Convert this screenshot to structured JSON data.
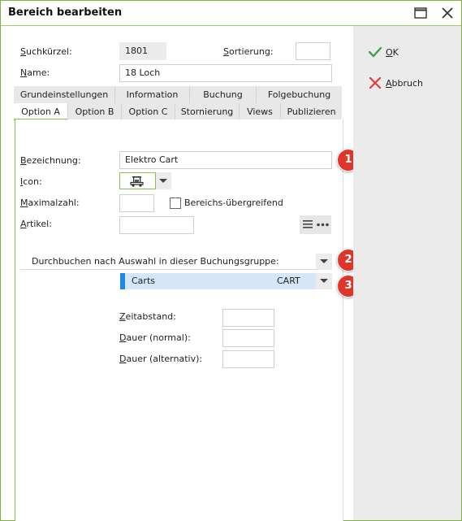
{
  "window": {
    "title": "Bereich bearbeiten",
    "maximize_icon": "maximize-icon",
    "close_icon": "close-icon"
  },
  "header": {
    "suchkuerzel_label": "Suchkürzel:",
    "suchkuerzel_value": "1801",
    "sortierung_label": "Sortierung:",
    "sortierung_value": "",
    "name_label": "Name:",
    "name_value": "18 Loch"
  },
  "tabs_row1": [
    "Grundeinstellungen",
    "Information",
    "Buchung",
    "Folgebuchung"
  ],
  "tabs_row2": [
    "Option A",
    "Option B",
    "Option C",
    "Stornierung",
    "Views",
    "Publizieren"
  ],
  "active_tab": "Option A",
  "form": {
    "bezeichnung_label": "Bezeichnung:",
    "bezeichnung_value": "Elektro Cart",
    "icon_label": "Icon:",
    "icon_name": "golf-cart-icon",
    "maximalzahl_label": "Maximalzahl:",
    "maximalzahl_value": "",
    "bereichs_label": "Bereichs-übergreifend",
    "bereichs_checked": false,
    "artikel_label": "Artikel:",
    "artikel_value": "",
    "durchbuchen_value": "Durchbuchen nach Auswahl in dieser Buchungsgruppe:",
    "group_name": "Carts",
    "group_code": "CART",
    "zeitabstand_label": "Zeitabstand:",
    "zeitabstand_value": "",
    "dauer_normal_label": "Dauer (normal):",
    "dauer_normal_value": "",
    "dauer_alt_label": "Dauer (alternativ):",
    "dauer_alt_value": ""
  },
  "badges": [
    "1",
    "2",
    "3"
  ],
  "actions": {
    "ok_label": "OK",
    "abbruch_label": "Abbruch"
  },
  "colors": {
    "accent_green": "#8bc34a",
    "badge_red": "#e0352b",
    "selection_blue": "#d6e6f7",
    "selection_bar": "#1e88e5"
  }
}
